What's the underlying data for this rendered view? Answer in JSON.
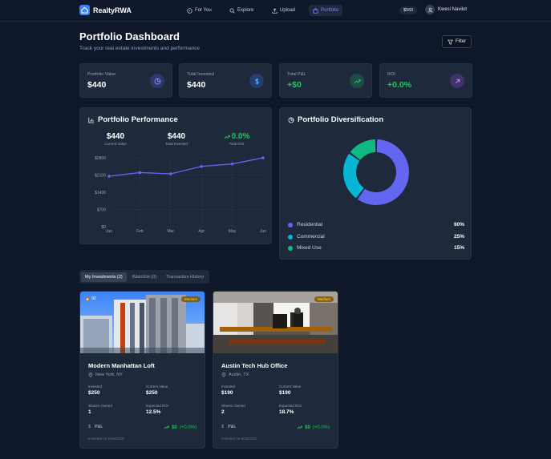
{
  "app": {
    "name": "RealtyRWA"
  },
  "nav": {
    "items": [
      {
        "label": "For You",
        "icon": "compass-icon"
      },
      {
        "label": "Explore",
        "icon": "search-icon"
      },
      {
        "label": "Upload",
        "icon": "upload-icon"
      },
      {
        "label": "Portfolio",
        "icon": "briefcase-icon",
        "active": true
      }
    ],
    "balance": "$560",
    "user": "Kwesi Navilot"
  },
  "header": {
    "title": "Portfolio Dashboard",
    "subtitle": "Track your real estate investments and performance",
    "filter_label": "Filter"
  },
  "stats": [
    {
      "label": "Portfolio Value",
      "value": "$440",
      "icon": "pie-chart-icon",
      "color": "#6366f1"
    },
    {
      "label": "Total Invested",
      "value": "$440",
      "icon": "dollar-icon",
      "color": "#3b82f6"
    },
    {
      "label": "Total P&L",
      "value": "+$0",
      "icon": "trending-up-icon",
      "color": "#22c55e"
    },
    {
      "label": "ROI",
      "value": "+0.0%",
      "icon": "arrow-up-right-icon",
      "color": "#a855f7"
    }
  ],
  "performance": {
    "title": "Portfolio Performance",
    "metrics": [
      {
        "value": "$440",
        "label": "Current Value"
      },
      {
        "value": "$440",
        "label": "Total Invested"
      },
      {
        "value": "0.0%",
        "label": "Total ROI"
      }
    ]
  },
  "chart_data": [
    {
      "type": "line",
      "x": [
        "Jan",
        "Feb",
        "Mar",
        "Apr",
        "May",
        "Jun"
      ],
      "series": [
        {
          "values": [
            2050,
            2200,
            2150,
            2450,
            2550,
            2800
          ],
          "color": "#6366f1"
        }
      ],
      "yticks": [
        "$0",
        "$700",
        "$1400",
        "$2100",
        "$2800"
      ],
      "ylim": [
        0,
        2800
      ],
      "grid": true
    },
    {
      "type": "pie",
      "title": "Portfolio Diversification",
      "categories": [
        "Residential",
        "Commercial",
        "Mixed Use"
      ],
      "values": [
        60,
        25,
        15
      ],
      "labels": [
        "60%",
        "25%",
        "15%"
      ],
      "colors": [
        "#6366f1",
        "#06b6d4",
        "#10b981"
      ]
    }
  ],
  "tabs": [
    {
      "label": "My Investments (2)",
      "active": true
    },
    {
      "label": "Watchlist (0)"
    },
    {
      "label": "Transaction History"
    }
  ],
  "cards": [
    {
      "badge": "Medium",
      "likes": "92",
      "name": "Modern Manhattan Loft",
      "location": "New York, NY",
      "invested_label": "Invested",
      "invested": "$250",
      "current_label": "Current Value",
      "current": "$250",
      "shares_label": "Shares Owned",
      "shares": "1",
      "roi_label": "Expected ROI",
      "roi": "12.5%",
      "pnl_label": "P&L",
      "pnl": "$0",
      "pnl_pct": "(+0.0%)",
      "date": "Invested on 6/18/2025"
    },
    {
      "badge": "Medium",
      "name": "Austin Tech Hub Office",
      "location": "Austin, TX",
      "invested_label": "Invested",
      "invested": "$190",
      "current_label": "Current Value",
      "current": "$190",
      "shares_label": "Shares Owned",
      "shares": "2",
      "roi_label": "Expected ROI",
      "roi": "18.7%",
      "pnl_label": "P&L",
      "pnl": "$0",
      "pnl_pct": "(+0.0%)",
      "date": "Invested on 6/18/2025"
    }
  ]
}
